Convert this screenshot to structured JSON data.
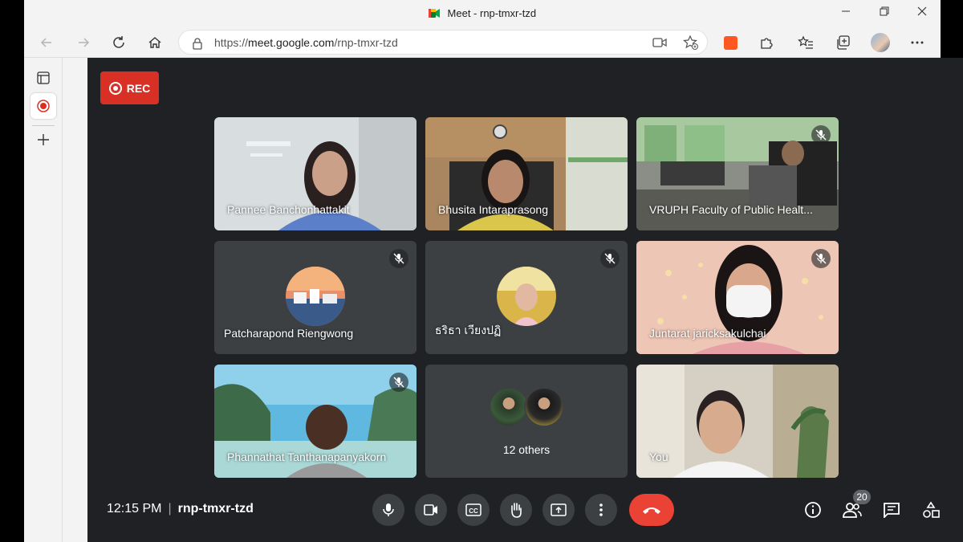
{
  "window": {
    "title": "Meet - rnp-tmxr-tzd"
  },
  "browser": {
    "url_prefix": "https://",
    "url_host": "meet.google.com",
    "url_path": "/rnp-tmxr-tzd"
  },
  "meeting": {
    "rec_label": "REC",
    "time": "12:15 PM",
    "code": "rnp-tmxr-tzd",
    "participant_count": "20",
    "others_label": "12 others"
  },
  "participants": [
    {
      "name": "Pannee Banchonhattakit",
      "muted": false,
      "video": true
    },
    {
      "name": "Bhusita Intaraprasong",
      "muted": false,
      "video": true
    },
    {
      "name": "VRUPH Faculty of Public Healt...",
      "muted": true,
      "video": true
    },
    {
      "name": "Patcharapond Riengwong",
      "muted": true,
      "video": false
    },
    {
      "name": "ธริธา เวียงปฏิ",
      "muted": true,
      "video": false
    },
    {
      "name": "Juntarat jaricksakulchai",
      "muted": true,
      "video": true,
      "speaking": true
    },
    {
      "name": "Phannathat Tanthanapanyakorn",
      "muted": true,
      "video": true
    },
    {
      "name": "You",
      "muted": false,
      "video": true
    }
  ],
  "colors": {
    "rec_red": "#d93025",
    "end_call_red": "#ea4335",
    "meet_bg": "#202124",
    "tile_bg": "#3c4043",
    "speaking_outline": "#8ab4f8"
  }
}
